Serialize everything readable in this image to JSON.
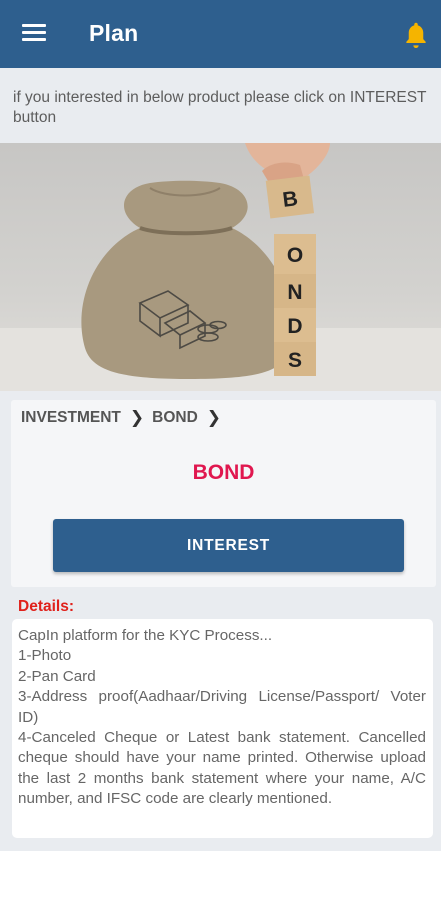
{
  "header": {
    "title": "Plan",
    "menu_icon": "hamburger-menu-icon",
    "notification_icon": "bell-icon",
    "background": "#2e5f8e",
    "bell_color": "#f5b400"
  },
  "hint": {
    "text": "if you interested in below product please click on INTEREST button"
  },
  "hero": {
    "blocks": [
      "B",
      "O",
      "N",
      "D",
      "S"
    ]
  },
  "product": {
    "breadcrumb": [
      "INVESTMENT",
      "BOND"
    ],
    "name": "BOND",
    "interest_label": "INTEREST",
    "accent": "#e0174f"
  },
  "details": {
    "label": "Details:",
    "lines": [
      "CapIn platform for the KYC Process...",
      "1-Photo",
      "2-Pan Card",
      "3-Address proof(Aadhaar/Driving License/Passport/ Voter ID)",
      "4-Canceled Cheque or Latest bank statement. Cancelled cheque should have your name printed. Otherwise upload the last 2 months bank statement where your name, A/C number, and IFSC code are clearly mentioned."
    ]
  }
}
